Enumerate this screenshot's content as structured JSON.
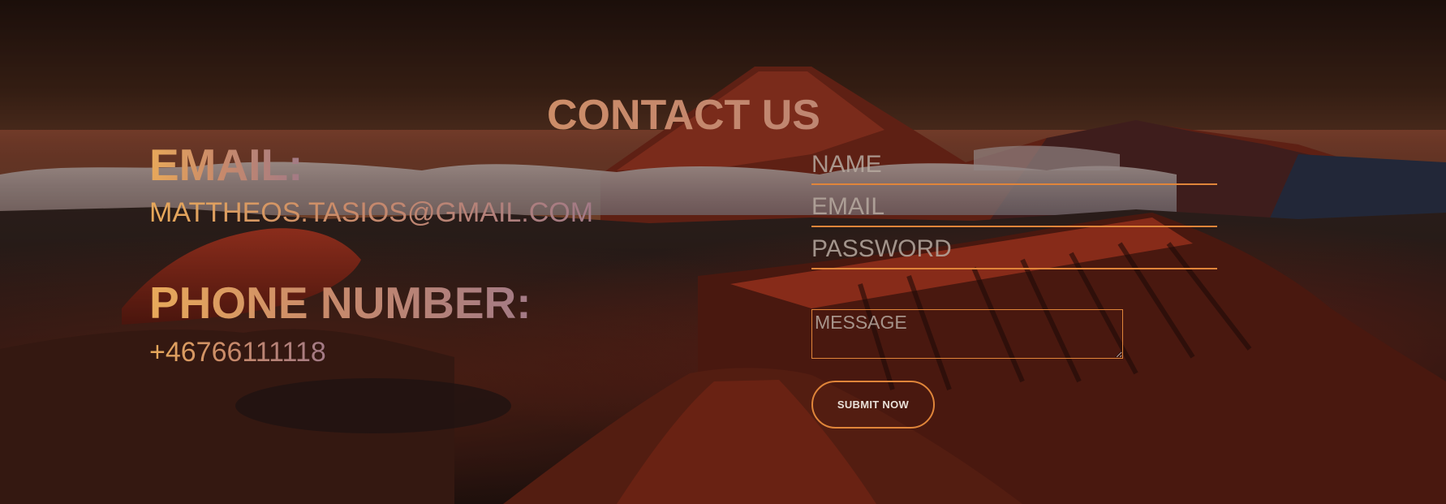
{
  "page": {
    "title": "CONTACT US"
  },
  "contact_info": {
    "email_heading": "EMAIL:",
    "email_value": "MATTHEOS.TASIOS@GMAIL.COM",
    "phone_heading": "PHONE NUMBER:",
    "phone_value": "+46766111118"
  },
  "form": {
    "name_placeholder": "NAME",
    "email_placeholder": "EMAIL",
    "password_placeholder": "PASSWORD",
    "message_placeholder": "MESSAGE",
    "submit_label": "SUBMIT NOW"
  },
  "colors": {
    "accent": "#e0853a",
    "heading_gradient_start": "#e8a95a",
    "heading_gradient_end": "#a27a86",
    "sky_top": "#2a1610",
    "lava_red": "#c8321e"
  },
  "background": {
    "image_description_icon": "volcano-landscape-image"
  }
}
